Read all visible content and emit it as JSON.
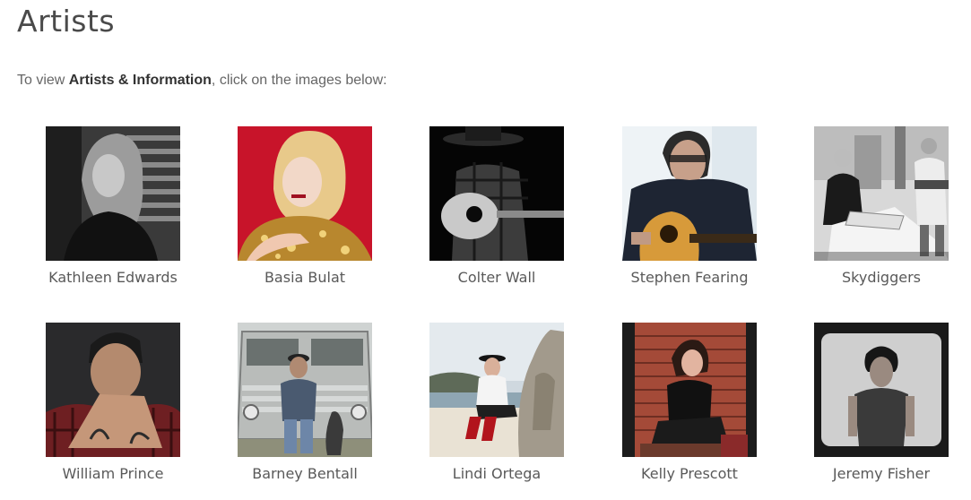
{
  "page": {
    "title": "Artists",
    "intro_prefix": "To view ",
    "intro_bold": "Artists & Information",
    "intro_suffix": ", click on the images below:"
  },
  "artists": [
    {
      "name": "Kathleen Edwards",
      "photo": "portrait-icon",
      "tone": "mono"
    },
    {
      "name": "Basia Bulat",
      "photo": "portrait-icon",
      "tone": "color-red"
    },
    {
      "name": "Colter Wall",
      "photo": "guitar-icon",
      "tone": "mono-dark"
    },
    {
      "name": "Stephen Fearing",
      "photo": "guitar-icon",
      "tone": "color-light"
    },
    {
      "name": "Skydiggers",
      "photo": "band-icon",
      "tone": "mono-light"
    },
    {
      "name": "William Prince",
      "photo": "portrait-icon",
      "tone": "color-dark"
    },
    {
      "name": "Barney Bentall",
      "photo": "bus-icon",
      "tone": "color-muted"
    },
    {
      "name": "Lindi Ortega",
      "photo": "beach-icon",
      "tone": "color-sky"
    },
    {
      "name": "Kelly Prescott",
      "photo": "brick-wall-icon",
      "tone": "color-brick"
    },
    {
      "name": "Jeremy Fisher",
      "photo": "portrait-icon",
      "tone": "mono-frame"
    }
  ]
}
